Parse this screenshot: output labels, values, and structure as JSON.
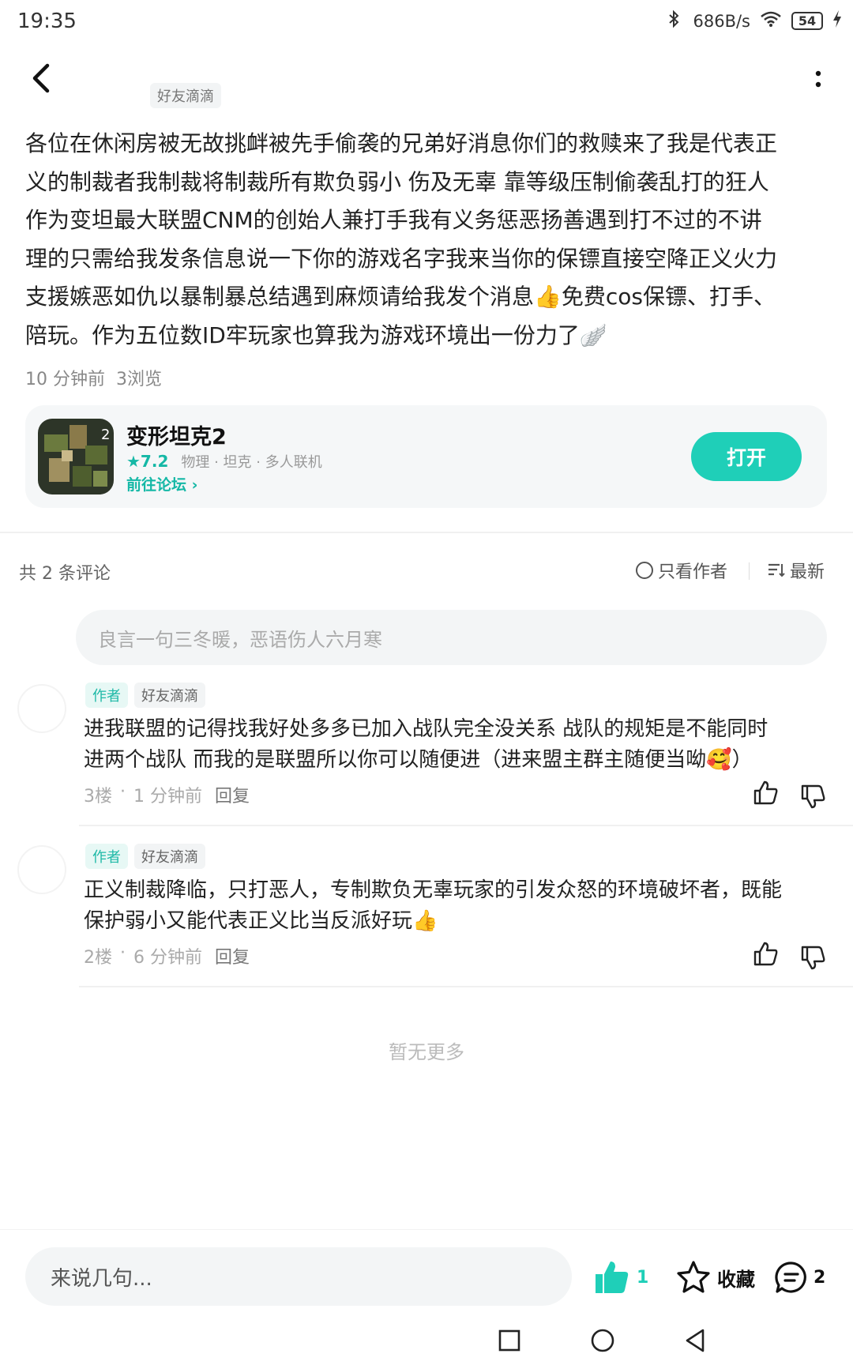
{
  "status_bar": {
    "time": "19:35",
    "net_speed": "686B/s",
    "battery": "54"
  },
  "header": {
    "author_tag": "好友滴滴"
  },
  "post": {
    "body_lines": [
      "各位在休闲房被无故挑衅被先手偷袭的兄弟好消息你们的救赎来了我是代表正",
      "义的制裁者我制裁将制裁所有欺负弱小 伤及无辜 靠等级压制偷袭乱打的狂人",
      "作为变坦最大联盟CNM的创始人兼打手我有义务惩恶扬善遇到打不过的不讲",
      "理的只需给我发条信息说一下你的游戏名字我来当你的保镖直接空降正义火力",
      "支援嫉恶如仇以暴制暴总结遇到麻烦请给我发个消息👍免费cos保镖、打手、",
      "陪玩。作为五位数ID牢玩家也算我为游戏环境出一份力了🪽"
    ],
    "time": "10 分钟前",
    "views": "3浏览"
  },
  "game_card": {
    "name": "变形坦克2",
    "rating": "★7.2",
    "tags": "物理 · 坦克 · 多人联机",
    "forum_link": "前往论坛 ›",
    "open_label": "打开"
  },
  "comments_header": {
    "count": "共 2 条评论",
    "author_only": "只看作者",
    "sort": "最新"
  },
  "comment_input": {
    "placeholder": "良言一句三冬暖，恶语伤人六月寒"
  },
  "comments": [
    {
      "author_badge": "作者",
      "name": "好友滴滴",
      "lines": [
        "进我联盟的记得找我好处多多已加入战队完全没关系 战队的规矩是不能同时",
        "进两个战队 而我的是联盟所以你可以随便进（进来盟主群主随便当呦🥰）"
      ],
      "floor": "3楼",
      "time": "1 分钟前",
      "reply": "回复"
    },
    {
      "author_badge": "作者",
      "name": "好友滴滴",
      "lines": [
        "正义制裁降临，只打恶人，专制欺负无辜玩家的引发众怒的环境破坏者，既能",
        "保护弱小又能代表正义比当反派好玩👍"
      ],
      "floor": "2楼",
      "time": "6 分钟前",
      "reply": "回复"
    }
  ],
  "no_more": "暂无更多",
  "bottom_bar": {
    "reply_placeholder": "来说几句...",
    "like_count": "1",
    "favorite_label": "收藏",
    "comment_count": "2"
  },
  "colors": {
    "accent": "#1fcfb8",
    "accent_text": "#15b8a6"
  },
  "icons": [
    "back-arrow-icon",
    "more-vertical-icon",
    "thumb-up-icon",
    "thumb-down-icon",
    "star-icon",
    "comment-bubble-icon",
    "sort-icon",
    "radio-icon",
    "square-nav-icon",
    "circle-nav-icon",
    "triangle-back-nav-icon",
    "wifi-icon",
    "bluetooth-icon",
    "charging-icon"
  ]
}
